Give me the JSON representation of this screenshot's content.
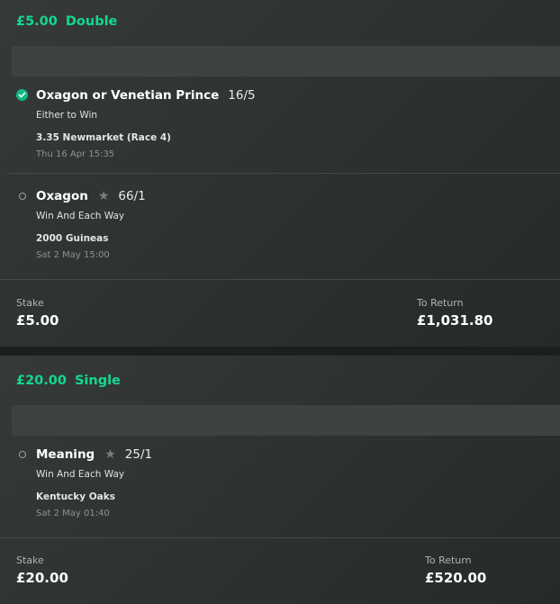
{
  "bets": [
    {
      "amount": "£5.00",
      "type": "Double",
      "selections": [
        {
          "status_icon": "check-circle-icon",
          "name": "Oxagon or Venetian Prince",
          "odds": "16/5",
          "market": "Either to Win",
          "event": "3.35 Newmarket (Race 4)",
          "time": "Thu 16 Apr 15:35"
        },
        {
          "status_icon": "open-circle-icon",
          "name": "Oxagon",
          "odds": "66/1",
          "market": "Win And Each Way",
          "event": "2000 Guineas",
          "time": "Sat 2 May 15:00"
        }
      ],
      "stake_label": "Stake",
      "stake": "£5.00",
      "return_label": "To Return",
      "return_value": "£1,031.80"
    },
    {
      "amount": "£20.00",
      "type": "Single",
      "selections": [
        {
          "status_icon": "open-circle-icon",
          "name": "Meaning",
          "odds": "25/1",
          "market": "Win And Each Way",
          "event": "Kentucky Oaks",
          "time": "Sat 2 May 01:40"
        }
      ],
      "stake_label": "Stake",
      "stake": "£20.00",
      "return_label": "To Return",
      "return_value": "£520.00"
    }
  ],
  "colors": {
    "accent": "#12d990",
    "card": "#2e3332",
    "bar": "#3e4342"
  }
}
